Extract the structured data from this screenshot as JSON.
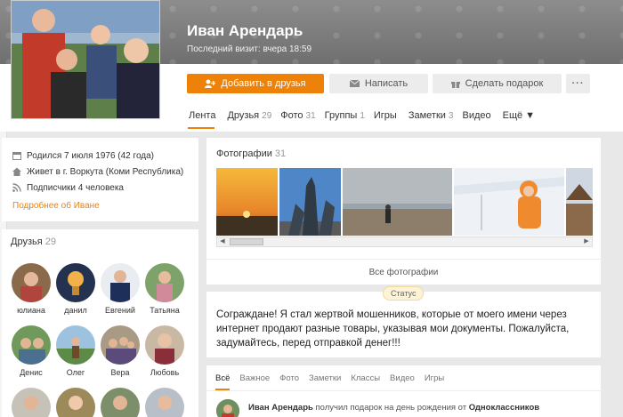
{
  "profile": {
    "name": "Иван Арендарь",
    "last_visit": "Последний визит: вчера 18:59"
  },
  "actions": {
    "add_friend": "Добавить в друзья",
    "message": "Написать",
    "gift": "Сделать подарок",
    "more": "···"
  },
  "tabs": [
    {
      "label": "Лента",
      "count": ""
    },
    {
      "label": "Друзья",
      "count": "29"
    },
    {
      "label": "Фото",
      "count": "31"
    },
    {
      "label": "Группы",
      "count": "1"
    },
    {
      "label": "Игры",
      "count": ""
    },
    {
      "label": "Заметки",
      "count": "3"
    },
    {
      "label": "Видео",
      "count": ""
    },
    {
      "label": "Ещё ▼",
      "count": ""
    }
  ],
  "info": {
    "born": "Родился 7 июля 1976 (42 года)",
    "lives": "Живет в г. Воркута (Коми Республика)",
    "subscribers": "Подписчики 4 человека",
    "more_link": "Подробнее об Иване"
  },
  "friends": {
    "title": "Друзья",
    "count": "29",
    "items": [
      "юлиана",
      "данил",
      "Евгений",
      "Татьяна",
      "Денис",
      "Олег",
      "Вера",
      "Любовь",
      "",
      "",
      "",
      ""
    ]
  },
  "photos": {
    "title": "Фотографии",
    "count": "31",
    "all_label": "Все фотографии"
  },
  "status": {
    "badge": "Статус",
    "text": "Сограждане! Я стал жертвой мошенников, которые от моего имени через интернет продают разные товары, указывая мои документы. Пожалуйста, задумайтесь, перед отправкой денег!!!"
  },
  "feed": {
    "tabs": [
      "Всё",
      "Важное",
      "Фото",
      "Заметки",
      "Классы",
      "Видео",
      "Игры"
    ],
    "item_author": "Иван Арендарь",
    "item_text": "получил подарок на день рождения от",
    "item_source": "Одноклассников"
  },
  "colors": {
    "accent": "#ee8208",
    "header": "#7a7a7a"
  }
}
